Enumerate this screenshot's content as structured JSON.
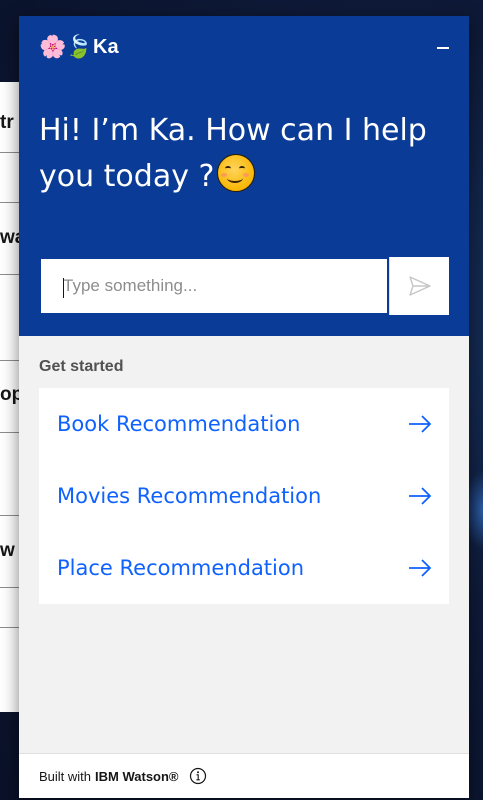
{
  "background_page": {
    "fragments": [
      "tr",
      "wa",
      "op",
      "w"
    ]
  },
  "widget": {
    "brand": {
      "emoji_1": "🌸",
      "emoji_2": "🍃",
      "name": "Ka"
    },
    "minimize_icon": "minimize-icon",
    "greeting": "Hi! I’m Ka. How can I help you today ?",
    "greeting_emoji": "smiling-face-icon",
    "input": {
      "placeholder": "Type something..."
    },
    "send_icon": "send-icon",
    "get_started": {
      "title": "Get started",
      "options": [
        {
          "label": "Book Recommendation"
        },
        {
          "label": "Movies Recommendation"
        },
        {
          "label": "Place Recommendation"
        }
      ]
    },
    "footer": {
      "built_with": "Built with",
      "brand": "IBM Watson®",
      "info_icon": "info-icon"
    }
  },
  "colors": {
    "header_bg": "#0a3b96",
    "link": "#0f62fe",
    "panel_bg": "#f2f2f2"
  }
}
